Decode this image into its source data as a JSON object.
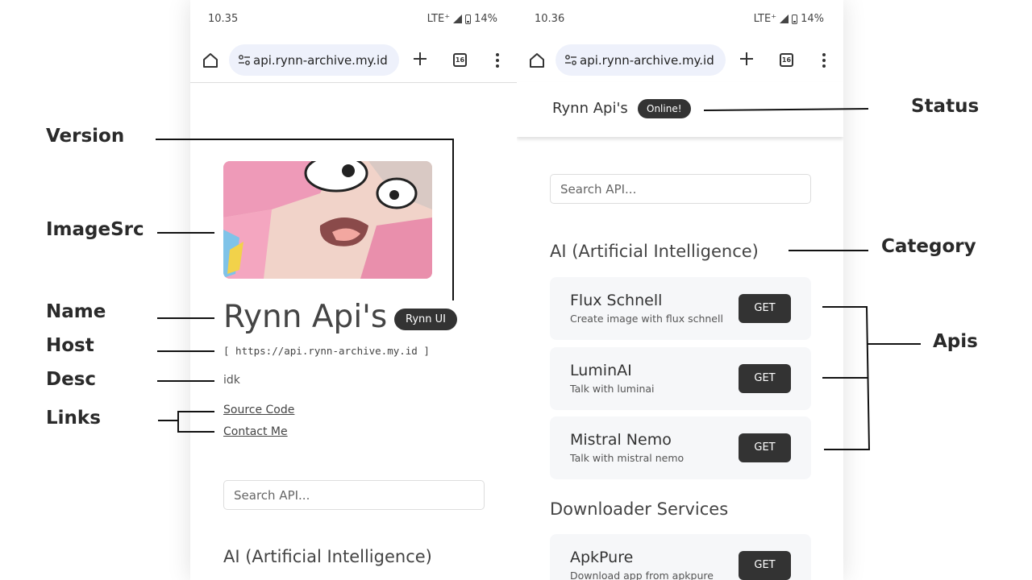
{
  "left_phone": {
    "status_time": "10.35",
    "network": "LTE⁺",
    "battery": "14%",
    "url": "api.rynn-archive.my.id",
    "tab_count": "16",
    "name": "Rynn Api's",
    "version": "Rynn UI",
    "host": "[ https://api.rynn-archive.my.id ]",
    "desc": "idk",
    "links": [
      "Source Code",
      "Contact Me"
    ],
    "search_placeholder": "Search API...",
    "category": "AI (Artificial Intelligence)"
  },
  "right_phone": {
    "status_time": "10.36",
    "network": "LTE⁺",
    "battery": "14%",
    "url": "api.rynn-archive.my.id",
    "tab_count": "16",
    "title": "Rynn Api's",
    "status": "Online!",
    "search_placeholder": "Search API...",
    "categories": [
      {
        "name": "AI (Artificial Intelligence)",
        "apis": [
          {
            "name": "Flux Schnell",
            "desc": "Create image with flux schnell",
            "button": "GET"
          },
          {
            "name": "LuminAI",
            "desc": "Talk with luminai",
            "button": "GET"
          },
          {
            "name": "Mistral Nemo",
            "desc": "Talk with mistral nemo",
            "button": "GET"
          }
        ]
      },
      {
        "name": "Downloader Services",
        "apis": [
          {
            "name": "ApkPure",
            "desc": "Download app from apkpure",
            "button": "GET"
          }
        ]
      }
    ]
  },
  "annotations": {
    "version": "Version",
    "image_src": "ImageSrc",
    "name": "Name",
    "host": "Host",
    "desc": "Desc",
    "links": "Links",
    "status": "Status",
    "category": "Category",
    "apis": "Apis"
  },
  "colors": {
    "pill": "#333333",
    "url_bar": "#eef1fb",
    "card": "#f6f7f9",
    "hero_pink": "#f4a6c0"
  }
}
